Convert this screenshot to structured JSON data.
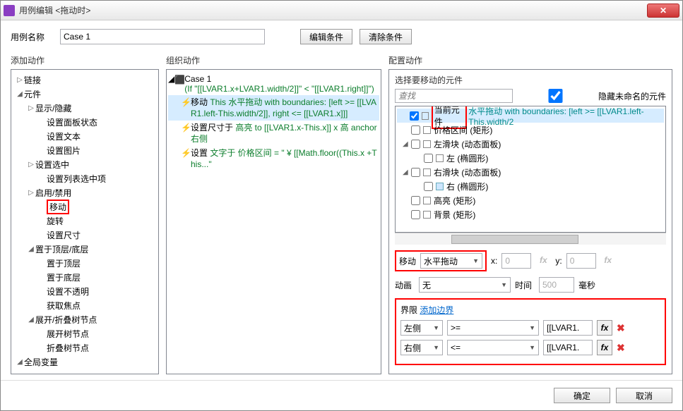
{
  "window": {
    "title": "用例编辑 <拖动时>"
  },
  "namerow": {
    "label": "用例名称",
    "value": "Case 1",
    "editBtn": "编辑条件",
    "clearBtn": "清除条件"
  },
  "heads": {
    "left": "添加动作",
    "mid": "组织动作",
    "right": "配置动作"
  },
  "leftTree": [
    {
      "ind": 0,
      "arr": "▷",
      "label": "链接"
    },
    {
      "ind": 0,
      "arr": "◢",
      "label": "元件"
    },
    {
      "ind": 1,
      "arr": "▷",
      "label": "显示/隐藏"
    },
    {
      "ind": 2,
      "arr": "",
      "label": "设置面板状态"
    },
    {
      "ind": 2,
      "arr": "",
      "label": "设置文本"
    },
    {
      "ind": 2,
      "arr": "",
      "label": "设置图片"
    },
    {
      "ind": 1,
      "arr": "▷",
      "label": "设置选中"
    },
    {
      "ind": 2,
      "arr": "",
      "label": "设置列表选中项"
    },
    {
      "ind": 1,
      "arr": "▷",
      "label": "启用/禁用"
    },
    {
      "ind": 2,
      "arr": "",
      "label": "移动",
      "red": true
    },
    {
      "ind": 2,
      "arr": "",
      "label": "旋转"
    },
    {
      "ind": 2,
      "arr": "",
      "label": "设置尺寸"
    },
    {
      "ind": 1,
      "arr": "◢",
      "label": "置于顶层/底层"
    },
    {
      "ind": 2,
      "arr": "",
      "label": "置于顶层"
    },
    {
      "ind": 2,
      "arr": "",
      "label": "置于底层"
    },
    {
      "ind": 2,
      "arr": "",
      "label": "设置不透明"
    },
    {
      "ind": 2,
      "arr": "",
      "label": "获取焦点"
    },
    {
      "ind": 1,
      "arr": "◢",
      "label": "展开/折叠树节点"
    },
    {
      "ind": 2,
      "arr": "",
      "label": "展开树节点"
    },
    {
      "ind": 2,
      "arr": "",
      "label": "折叠树节点"
    },
    {
      "ind": 0,
      "arr": "◢",
      "label": "全局变量"
    }
  ],
  "mid": {
    "caseName": "Case 1",
    "caseCond": "(If \"[[LVAR1.x+LVAR1.width/2]]\" < \"[[LVAR1.right]]\")",
    "rows": [
      {
        "pre": "移动 ",
        "body": "This 水平拖动 with boundaries: [left >= [[LVAR1.left-This.width/2]], right <= [[LVAR1.x]]]",
        "sel": true
      },
      {
        "pre": "设置尺寸于 ",
        "body": "高亮 to [[LVAR1.x-This.x]] x 高 anchor 右侧"
      },
      {
        "pre": "设置 ",
        "body": "文字于 价格区间 = \" ¥ [[Math.floor((This.x +This...\""
      }
    ]
  },
  "right": {
    "title": "选择要移动的元件",
    "searchPH": "查找",
    "hideChk": "隐藏未命名的元件",
    "tree": [
      {
        "ind": 0,
        "chk": true,
        "label": "当前元件",
        "red": true,
        "suffix": "水平拖动 with boundaries: [left >= [[LVAR1.left-This.width/2",
        "sel": true,
        "teal": true
      },
      {
        "ind": 0,
        "chk": false,
        "label": "价格区间 (矩形)"
      },
      {
        "ind": 0,
        "arr": "◢",
        "chk": false,
        "label": "左滑块 (动态面板)"
      },
      {
        "ind": 1,
        "chk": false,
        "label": "左 (椭圆形)"
      },
      {
        "ind": 0,
        "arr": "◢",
        "chk": false,
        "label": "右滑块 (动态面板)"
      },
      {
        "ind": 1,
        "chk": false,
        "label": "右 (椭圆形)",
        "bluebox": true
      },
      {
        "ind": 0,
        "chk": false,
        "label": "高亮 (矩形)"
      },
      {
        "ind": 0,
        "chk": false,
        "label": "背景 (矩形)"
      }
    ],
    "move": {
      "label": "移动",
      "value": "水平拖动",
      "x": "x:",
      "xv": "0",
      "y": "y:",
      "yv": "0"
    },
    "anim": {
      "label": "动画",
      "value": "无",
      "durLabel": "时间",
      "durVal": "500",
      "unit": "毫秒"
    },
    "bounds": {
      "label": "界限",
      "link": "添加边界",
      "rows": [
        {
          "side": "左侧",
          "op": ">=",
          "val": "[[LVAR1."
        },
        {
          "side": "右侧",
          "op": "<=",
          "val": "[[LVAR1."
        }
      ]
    }
  },
  "footer": {
    "ok": "确定",
    "cancel": "取消"
  },
  "chart_data": {
    "type": "table",
    "note": "no chart present"
  }
}
